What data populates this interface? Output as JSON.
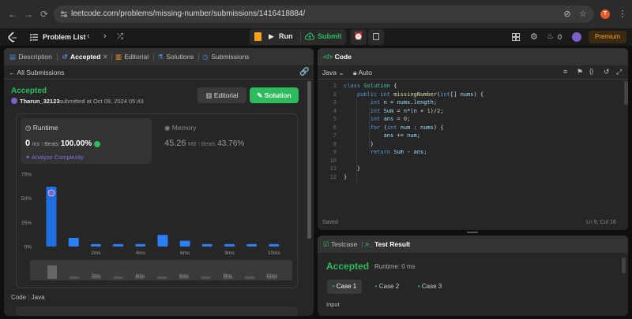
{
  "browser": {
    "url": "leetcode.com/problems/missing-number/submissions/1416418884/",
    "profile_initial": "T"
  },
  "appbar": {
    "problem_list": "Problem List",
    "run": "Run",
    "submit": "Submit",
    "points": "0",
    "premium": "Premium"
  },
  "left_tabs": {
    "description": "Description",
    "accepted": "Accepted",
    "editorial": "Editorial",
    "solutions": "Solutions",
    "submissions": "Submissions"
  },
  "submission": {
    "back": "All Submissions",
    "status": "Accepted",
    "user": "Tharun_32123",
    "submitted": "submitted at Oct 09, 2024 05:43",
    "editorial_btn": "Editorial",
    "solution_btn": "Solution",
    "runtime_label": "Runtime",
    "runtime_value": "0",
    "runtime_unit": "ms",
    "runtime_beats_label": "Beats",
    "runtime_beats": "100.00%",
    "analyze": "Analyze Complexity",
    "memory_label": "Memory",
    "memory_value": "45.26",
    "memory_unit": "MB",
    "memory_beats_label": "Beats",
    "memory_beats": "43.76%",
    "code_label": "Code",
    "lang_label": "Java"
  },
  "chart_data": {
    "type": "bar",
    "y_ticks": [
      "75%",
      "50%",
      "25%",
      "0%"
    ],
    "ylim": [
      0,
      75
    ],
    "values": [
      62,
      9,
      2.5,
      2.5,
      2.5,
      12,
      6,
      2.5,
      2.5,
      2.5,
      2.5
    ],
    "x_ticks": [
      "2ms",
      "4ms",
      "6ms",
      "8ms",
      "10ms"
    ],
    "highlight_index": 0,
    "bar_color": "#2d7ff9",
    "highlight_color": "#1f6fe0"
  },
  "editor": {
    "title": "Code",
    "language": "Java",
    "mode": "Auto",
    "status": "Saved",
    "cursor": "Ln 9, Col 16",
    "lines": [
      {
        "n": "1",
        "html": "<span class='kw'>class</span> <span class='ty'>Solution</span> {"
      },
      {
        "n": "2",
        "html": "    <span class='kw'>public</span> <span class='kw'>int</span> <span class='fn'>missingNumber</span>(<span class='kw'>int</span>[] <span class='vr'>nums</span>) {"
      },
      {
        "n": "3",
        "html": "        <span class='kw'>int</span> <span class='vr'>n</span> = <span class='vr'>nums</span>.<span class='vr'>length</span>;"
      },
      {
        "n": "4",
        "html": "        <span class='kw'>int</span> <span class='vr'>Sum</span> = <span class='vr'>n</span>*(<span class='vr'>n</span> + <span class='nm'>1</span>)/<span class='nm'>2</span>;"
      },
      {
        "n": "5",
        "html": "        <span class='kw'>int</span> <span class='vr'>ans</span> = <span class='nm'>0</span>;"
      },
      {
        "n": "6",
        "html": "        <span class='kw'>for</span> (<span class='kw'>int</span> <span class='vr'>num</span> : <span class='vr'>nums</span>) {"
      },
      {
        "n": "7",
        "html": "            <span class='vr'>ans</span> += <span class='vr'>num</span>;"
      },
      {
        "n": "8",
        "html": "        }"
      },
      {
        "n": "9",
        "html": "        <span class='kw'>return</span> <span class='vr'>Sum</span> - <span class='vr'>ans</span>;"
      },
      {
        "n": "10",
        "html": ""
      },
      {
        "n": "11",
        "html": "    }"
      },
      {
        "n": "12",
        "html": "}"
      }
    ]
  },
  "results": {
    "testcase_tab": "Testcase",
    "result_tab": "Test Result",
    "status": "Accepted",
    "runtime": "Runtime: 0 ms",
    "cases": [
      "Case 1",
      "Case 2",
      "Case 3"
    ],
    "input_label": "Input"
  },
  "colors": {
    "accent_green": "#2cbb5d",
    "orange": "#f7a51c",
    "panel": "#262626"
  }
}
